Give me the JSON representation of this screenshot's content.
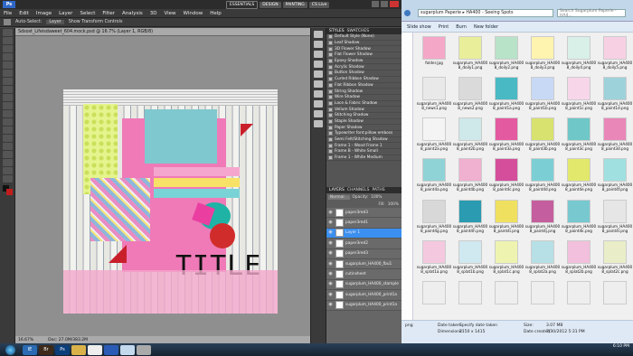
{
  "photoshop": {
    "logo": "Ps",
    "menus": [
      "File",
      "Edit",
      "Image",
      "Layer",
      "Select",
      "Filter",
      "Analysis",
      "3D",
      "View",
      "Window",
      "Help"
    ],
    "workspaces": [
      "ESSENTIALS",
      "DESIGN",
      "PAINTING"
    ],
    "cslive": "CS Live",
    "options": [
      "Auto-Select:",
      "Layer",
      "Show Transform Controls"
    ],
    "doc_tab": "Sdsost_Lifeisdaweet_604.mock.psd @ 16.7% (Layer 1, RGB/8)",
    "status_zoom": "16.67%",
    "status_doc": "Doc: 27.0M/383.2M",
    "canvas_title": "TITLE",
    "styles_tabs": [
      "STYLES",
      "SWATCHES"
    ],
    "styles": [
      "Default Style (None)",
      "Leaf Shadow",
      "3D Flower Shadow",
      "Flat Flower Shadow",
      "Epoxy Shadow",
      "Acrylic Shadow",
      "Button Shadow",
      "Curled Ribbon Shadow",
      "Flat Ribbon Shadow",
      "String Shadow",
      "Wire Shadow",
      "Lace & Fabric Shadow",
      "Vellum Shadow",
      "Stitching Shadow",
      "Staple Shadow",
      "Paper Shadow",
      "Typewriter font:pillow emboss",
      "Semi Felt/Stitching Shadow",
      "Frame 1 - Wood Frame 1",
      "Frame B - White Small",
      "Frame 1 - White Medium"
    ],
    "layers_tabs": [
      "LAYERS",
      "CHANNELS",
      "PATHS"
    ],
    "blend_mode": "Normal",
    "opacity_label": "Opacity:",
    "opacity": "100%",
    "fill_label": "Fill:",
    "fill": "100%",
    "layers": [
      "paper3red3",
      "paper3red1",
      "Layer 1",
      "paper3red2",
      "paper3red3",
      "sugarplum_HA400_fbu1",
      "cutinsheet",
      "sugarplum_HA400_stample",
      "sugarplum_HA400_print1a",
      "sugarplum_HA400_print1a"
    ],
    "selected_layer": "Layer 1"
  },
  "explorer": {
    "address": "sugarplum Paperie ▸ HA400 - Seeing Spots",
    "search_placeholder": "Search Sugarplum Paperie - HA4...",
    "commands": [
      "Slide show",
      "Print",
      "Burn",
      "New folder"
    ],
    "files": [
      "folder.jpg",
      "sugarplum_HA400\n8_doily1.png",
      "sugarplum_HA400\n8_doily2.png",
      "sugarplum_HA400\n8_doily3.png",
      "sugarplum_HA400\n8_doily4.png",
      "sugarplum_HA400\n8_doily5.png",
      "sugarplum_HA400\n8_news1.png",
      "sugarplum_HA400\n8_news2.png",
      "sugarplum_HA400\n8_paint1a.png",
      "sugarplum_HA400\n8_paint1b.png",
      "sugarplum_HA400\n8_paint1c.png",
      "sugarplum_HA400\n8_paint1d.png",
      "sugarplum_HA400\n8_paint2a.png",
      "sugarplum_HA400\n8_paint2b.png",
      "sugarplum_HA400\n8_paint3a.png",
      "sugarplum_HA400\n8_paint3b.png",
      "sugarplum_HA400\n8_paint3c.png",
      "sugarplum_HA400\n8_paint3d.png",
      "sugarplum_HA400\n8_paint4a.png",
      "sugarplum_HA400\n8_paint4b.png",
      "sugarplum_HA400\n8_paint4c.png",
      "sugarplum_HA400\n8_paint4d.png",
      "sugarplum_HA400\n8_paint4e.png",
      "sugarplum_HA400\n8_paint4f.png",
      "sugarplum_HA400\n8_paint4g.png",
      "sugarplum_HA400\n8_paint4h.png",
      "sugarplum_HA400\n8_paint4i.png",
      "sugarplum_HA400\n8_paint4j.png",
      "sugarplum_HA400\n8_paint4k.png",
      "sugarplum_HA400\n8_paint4l.png",
      "sugarplum_HA400\n8_splat1a.png",
      "sugarplum_HA400\n8_splat1b.png",
      "sugarplum_HA400\n8_splat1c.png",
      "sugarplum_HA400\n8_splat2a.png",
      "sugarplum_HA400\n8_splat2b.png",
      "sugarplum_HA400\n8_splat2c.png",
      "",
      "",
      "",
      "",
      "",
      ""
    ],
    "detail_type": "png",
    "date_taken_label": "Date taken:",
    "date_taken": "Specify date taken",
    "dimensions_label": "Dimensions:",
    "dimensions": "2150 x 1415",
    "size_label": "Size:",
    "size": "3.07 MB",
    "date_created_label": "Date created:",
    "date_created": "7/30/2012 5:31 PM"
  },
  "taskbar": {
    "apps": [
      "IE",
      "Br",
      "Ps",
      "Folder",
      "Chrome",
      "Word",
      "Explorer",
      "Snip"
    ],
    "time": "6:10 PM"
  }
}
